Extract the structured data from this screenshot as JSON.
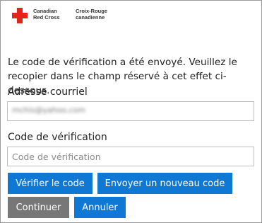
{
  "logo": {
    "english_lines": [
      "Canadian",
      "Red Cross"
    ],
    "french_lines": [
      "Croix-Rouge",
      "canadienne"
    ],
    "cross_color": "#e1251b"
  },
  "message": "Le code de vérification a été envoyé. Veuillez le recopier dans le champ réservé à cet effet ci-dessous.",
  "email": {
    "label": "Adresse courriel",
    "value": "mchis@yahoo.com"
  },
  "verification_code": {
    "label": "Code de vérification",
    "placeholder": "Code de vérification"
  },
  "buttons": {
    "verify": "Vérifier le code",
    "resend": "Envoyer un nouveau code",
    "continue": "Continuer",
    "cancel": "Annuler"
  },
  "colors": {
    "primary": "#0f78d4",
    "disabled": "#777777"
  }
}
